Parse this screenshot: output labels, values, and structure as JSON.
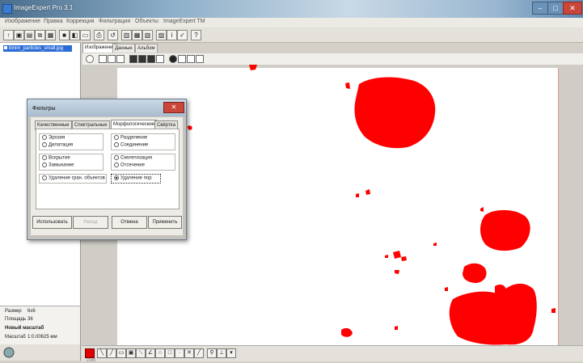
{
  "window": {
    "title": "ImageExpert Pro 3.1"
  },
  "window_buttons": {
    "minimize": "–",
    "maximize": "□",
    "close": "✕"
  },
  "menu": [
    "Изображение",
    "Правка",
    "Коррекция",
    "Фильтрация",
    "Объекты",
    "ImageExpert TM"
  ],
  "toolbar_icons": [
    "tool-1-icon",
    "open-icon",
    "save-as-icon",
    "copy-icon",
    "save-icon",
    "image-icon",
    "paste-icon",
    "print-icon",
    "undo-icon",
    "grid-icon",
    "table-icon",
    "export-icon",
    "window-icon",
    "info-icon",
    "check-icon",
    "help-icon"
  ],
  "file_list": {
    "selected_file": "binim_particles_small.jpg"
  },
  "view_tabs": [
    "Изображение",
    "Данные",
    "Альбом"
  ],
  "info": {
    "size_label": "Размер",
    "size_value": "6x6",
    "area_label": "Площадь",
    "area_value": "36",
    "new_scale_label": "Новый масштаб",
    "scale_label": "Масштаб",
    "scale_value": "1:0.00625 мм"
  },
  "bottom_status": "2240",
  "dialog": {
    "title": "Фильтры",
    "close": "✕",
    "tabs": [
      "Качественные",
      "Спектральные",
      "Морфологические",
      "Свёртка"
    ],
    "active_tab_index": 2,
    "groups": [
      {
        "options": [
          "Эрозия",
          "Дилатация"
        ]
      },
      {
        "options": [
          "Разделение",
          "Соединение"
        ]
      },
      {
        "options": [
          "Вскрытие",
          "Замыкание"
        ]
      },
      {
        "options": [
          "Скелетизация",
          "Отсечение"
        ]
      }
    ],
    "wide_options": [
      "Удаление гран. объектов",
      "Удаление пор"
    ],
    "selected_option": "Удаление пор",
    "buttons": {
      "use": "Использовать",
      "undo": "Назад",
      "cancel": "Отмена",
      "apply": "Применить"
    }
  },
  "colors": {
    "particle": "#ff0000",
    "selection": "#2b6bd6"
  }
}
